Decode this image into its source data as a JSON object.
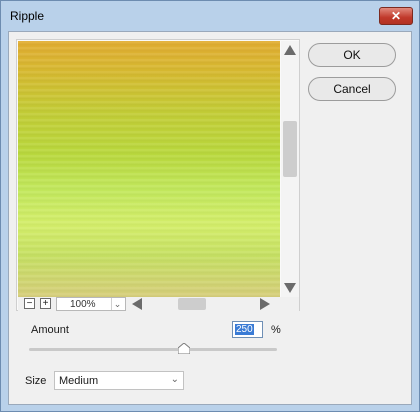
{
  "window": {
    "title": "Ripple",
    "close_glyph": "✕"
  },
  "preview": {
    "zoom_out_glyph": "−",
    "zoom_in_glyph": "+",
    "zoom_level": "100%",
    "zoom_chevron": "⌄"
  },
  "buttons": {
    "ok": "OK",
    "cancel": "Cancel"
  },
  "amount": {
    "label": "Amount",
    "value": "250",
    "unit": "%",
    "min": -999,
    "max": 999
  },
  "size": {
    "label": "Size",
    "selected": "Medium",
    "chevron": "⌄"
  },
  "colors": {
    "title_bar": "#b9d1ea",
    "close_button": "#c0392b",
    "selection": "#3a7bd5"
  },
  "icons": {
    "scroll_up": "triangle-up",
    "scroll_down": "triangle-down",
    "scroll_left": "triangle-left",
    "scroll_right": "triangle-right",
    "slider_thumb": "triangle-up"
  }
}
